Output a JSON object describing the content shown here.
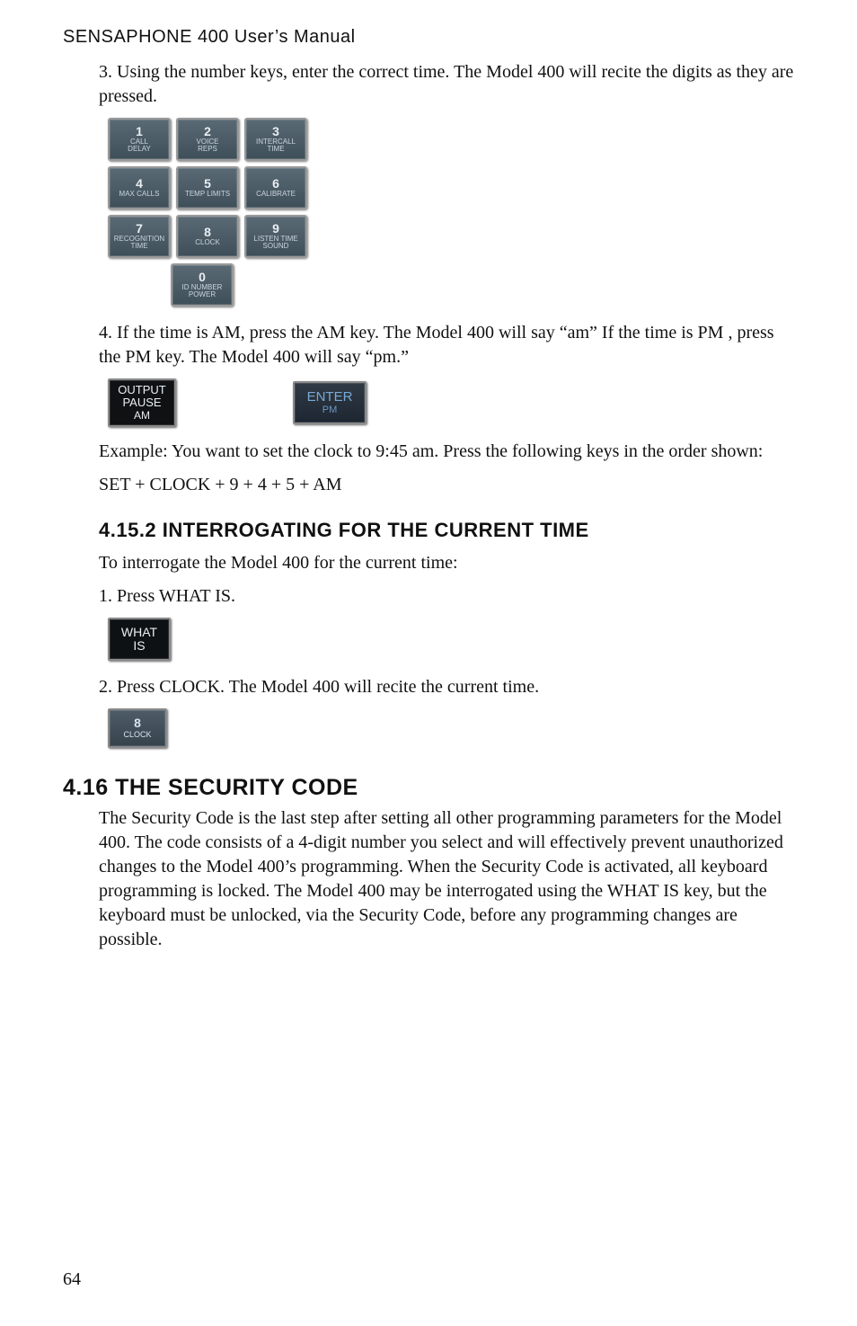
{
  "header": "SENSAPHONE 400 User’s Manual",
  "step3": "3. Using the number keys, enter the correct time. The Model 400 will recite the digits as they are pressed.",
  "keypad": {
    "r1": [
      {
        "num": "1",
        "lab": "CALL\nDELAY"
      },
      {
        "num": "2",
        "lab": "VOICE\nREPS"
      },
      {
        "num": "3",
        "lab": "INTERCALL\nTIME"
      }
    ],
    "r2": [
      {
        "num": "4",
        "lab": "MAX CALLS"
      },
      {
        "num": "5",
        "lab": "TEMP LIMITS"
      },
      {
        "num": "6",
        "lab": "CALIBRATE"
      }
    ],
    "r3": [
      {
        "num": "7",
        "lab": "RECOGNITION\nTIME"
      },
      {
        "num": "8",
        "lab": "CLOCK"
      },
      {
        "num": "9",
        "lab": "LISTEN TIME\nSOUND"
      }
    ],
    "r4": [
      {
        "num": "0",
        "lab": "ID NUMBER\nPOWER"
      }
    ]
  },
  "step4": "4. If the time is AM, press the AM key. The Model 400 will say “am” If the time is PM , press the PM key. The Model 400 will say “pm.”",
  "amkey": {
    "l1": "OUTPUT",
    "l2": "PAUSE",
    "l3": "AM"
  },
  "enterkey": {
    "l1": "ENTER",
    "l2": "PM"
  },
  "example": "Example: You want to set the clock to 9:45 am. Press the following keys in the order shown:",
  "sequence": "SET + CLOCK + 9 + 4 + 5 + AM",
  "h_4_15_2": "4.15.2 INTERROGATING FOR THE CURRENT TIME",
  "interrogate_intro": "To interrogate the Model 400 for the current time:",
  "interrogate_s1": "1. Press WHAT IS.",
  "whatis": {
    "l1": "WHAT",
    "l2": "IS"
  },
  "interrogate_s2": "2. Press CLOCK. The Model 400 will recite the current time.",
  "clockkey": {
    "num": "8",
    "lab": "CLOCK"
  },
  "h_4_16": "4.16 THE SECURITY CODE",
  "security_p": "The Security Code is the last step after setting all other programming parameters for the Model 400. The code consists of a 4-digit number you select and will effectively prevent unauthorized changes to the Model 400’s programming. When the Security Code is activated, all keyboard programming is locked. The Model 400 may be interrogated using the WHAT IS key, but the keyboard must be unlocked, via the Security Code, before any programming changes are possible.",
  "page_number": "64"
}
